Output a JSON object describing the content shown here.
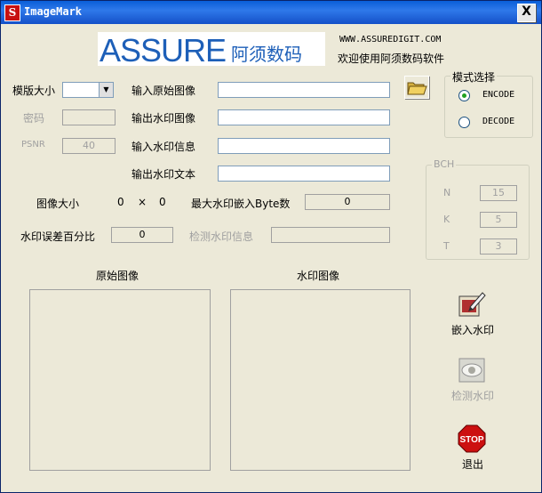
{
  "window": {
    "title": "ImageMark",
    "close_label": "X",
    "app_icon_letter": "S"
  },
  "banner": {
    "logo_text": "ASSURE",
    "logo_cn": "阿须数码",
    "url": "WWW.ASSUREDIGIT.COM",
    "welcome": "欢迎使用阿须数码软件"
  },
  "left": {
    "template_size_label": "模版大小",
    "password_label": "密码",
    "psnr_label": "PSNR",
    "psnr_value": "40"
  },
  "fields": {
    "input_image_label": "输入原始图像",
    "output_image_label": "输出水印图像",
    "input_wm_info_label": "输入水印信息",
    "output_wm_text_label": "输出水印文本"
  },
  "info": {
    "image_size_label": "图像大小",
    "width": "0",
    "times": "×",
    "height": "0",
    "max_bytes_label": "最大水印嵌入Byte数",
    "max_bytes_value": "0",
    "error_pct_label": "水印误差百分比",
    "error_pct_value": "0",
    "detect_info_label": "检测水印信息"
  },
  "mode": {
    "title": "模式选择",
    "encode": "ENCODE",
    "decode": "DECODE",
    "selected": "ENCODE"
  },
  "bch": {
    "title": "BCH",
    "n_label": "N",
    "n_value": "15",
    "k_label": "K",
    "k_value": "5",
    "t_label": "T",
    "t_value": "3"
  },
  "previews": {
    "original_label": "原始图像",
    "watermark_label": "水印图像"
  },
  "actions": {
    "embed_label": "嵌入水印",
    "detect_label": "检测水印",
    "exit_label": "退出",
    "stop_text": "STOP"
  },
  "colors": {
    "title_bar": "#0a5ed8",
    "logo_blue": "#1d5fb8",
    "logo_red": "#c81010",
    "stop_red": "#cc1010"
  }
}
